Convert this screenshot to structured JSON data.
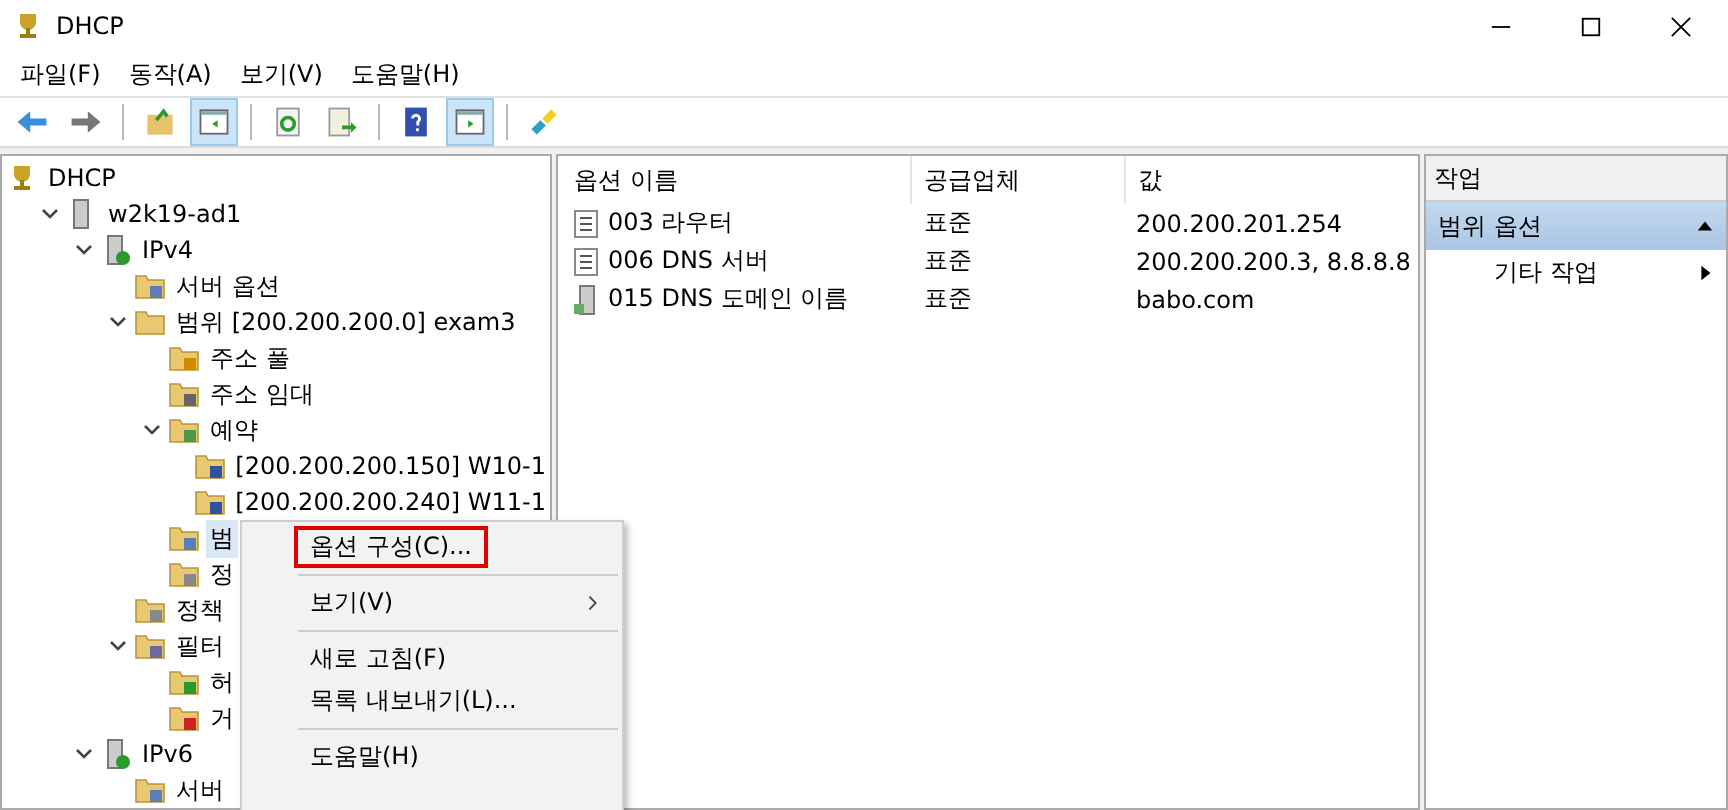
{
  "window": {
    "title": "DHCP"
  },
  "menu_bar": [
    "파일(F)",
    "동작(A)",
    "보기(V)",
    "도움말(H)"
  ],
  "toolbar": [
    {
      "kind": "back",
      "pressed": false
    },
    {
      "kind": "forward",
      "pressed": false
    },
    {
      "kind": "sep"
    },
    {
      "kind": "up",
      "pressed": false
    },
    {
      "kind": "tree",
      "pressed": true
    },
    {
      "kind": "sep"
    },
    {
      "kind": "refresh",
      "pressed": false
    },
    {
      "kind": "export",
      "pressed": false
    },
    {
      "kind": "sep"
    },
    {
      "kind": "help",
      "pressed": false
    },
    {
      "kind": "actionpane",
      "pressed": true
    },
    {
      "kind": "sep"
    },
    {
      "kind": "snapin",
      "pressed": false
    }
  ],
  "tree": [
    {
      "label": "DHCP",
      "kind": "dhcp",
      "selected": false,
      "children": [
        {
          "label": "w2k19-ad1",
          "kind": "server",
          "expanded": true,
          "selected": false,
          "children": [
            {
              "label": "IPv4",
              "kind": "ip",
              "expanded": true,
              "selected": false,
              "children": [
                {
                  "label": "서버 옵션",
                  "kind": "options",
                  "selected": false
                },
                {
                  "label": "범위 [200.200.200.0] exam3",
                  "kind": "folder",
                  "expanded": true,
                  "selected": false,
                  "children": [
                    {
                      "label": "주소 풀",
                      "kind": "pool",
                      "selected": false
                    },
                    {
                      "label": "주소 임대",
                      "kind": "lease",
                      "selected": false
                    },
                    {
                      "label": "예약",
                      "kind": "reserve",
                      "expanded": true,
                      "selected": false,
                      "children": [
                        {
                          "label": "[200.200.200.150] W10-1",
                          "kind": "entry",
                          "selected": false
                        },
                        {
                          "label": "[200.200.200.240] W11-1",
                          "kind": "entry",
                          "selected": false
                        }
                      ]
                    },
                    {
                      "label": "범",
                      "kind": "options",
                      "selected": true
                    },
                    {
                      "label": "정",
                      "kind": "policy",
                      "selected": false
                    }
                  ]
                },
                {
                  "label": "정책",
                  "kind": "policy",
                  "selected": false
                },
                {
                  "label": "필터",
                  "kind": "filter",
                  "expanded": true,
                  "selected": false,
                  "children": [
                    {
                      "label": "허",
                      "kind": "allow",
                      "selected": false
                    },
                    {
                      "label": "거",
                      "kind": "deny",
                      "selected": false
                    }
                  ]
                }
              ]
            },
            {
              "label": "IPv6",
              "kind": "ip",
              "expanded": true,
              "selected": false,
              "children": [
                {
                  "label": "서버",
                  "kind": "options",
                  "selected": false
                }
              ]
            }
          ]
        }
      ]
    }
  ],
  "table": {
    "columns": [
      "옵션 이름",
      "공급업체",
      "값"
    ],
    "rows": [
      {
        "kind": "list",
        "cells": [
          "003 라우터",
          "표준",
          "200.200.201.254"
        ]
      },
      {
        "kind": "list",
        "cells": [
          "006 DNS 서버",
          "표준",
          "200.200.200.3, 8.8.8.8"
        ]
      },
      {
        "kind": "server",
        "cells": [
          "015 DNS 도메인 이름",
          "표준",
          "babo.com"
        ]
      }
    ]
  },
  "actions": {
    "title": "작업",
    "section": {
      "label": "범위 옵션",
      "expanded": true
    },
    "items": [
      {
        "label": "기타 작업",
        "submenu": true
      }
    ]
  },
  "context_menu": [
    {
      "kind": "item",
      "label": "옵션 구성(C)...",
      "outlined": true,
      "submenu": false
    },
    {
      "kind": "separator"
    },
    {
      "kind": "item",
      "label": "보기(V)",
      "outlined": false,
      "submenu": true
    },
    {
      "kind": "separator"
    },
    {
      "kind": "item",
      "label": "새로 고침(F)",
      "outlined": false,
      "submenu": false
    },
    {
      "kind": "item",
      "label": "목록 내보내기(L)...",
      "outlined": false,
      "submenu": false
    },
    {
      "kind": "separator"
    },
    {
      "kind": "item",
      "label": "도움말(H)",
      "outlined": false,
      "submenu": false
    }
  ]
}
